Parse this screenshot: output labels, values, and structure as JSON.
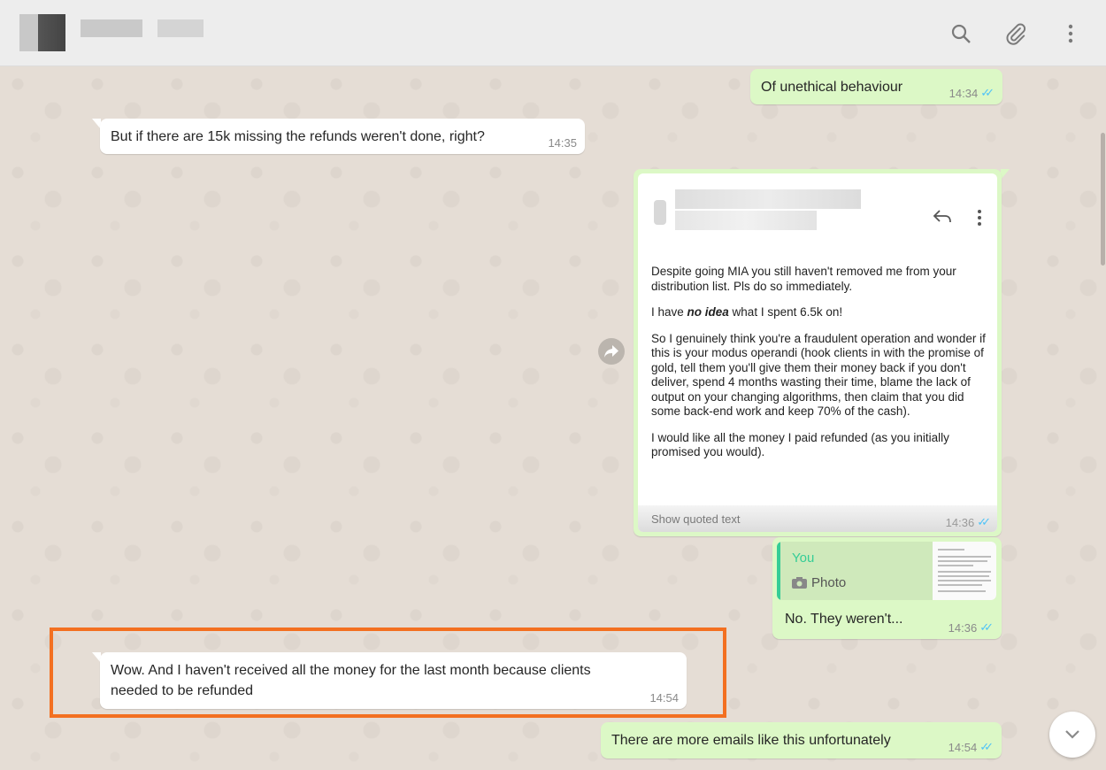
{
  "header": {
    "icons": [
      "search-icon",
      "paperclip-icon",
      "menu-dots-icon"
    ]
  },
  "messages": [
    {
      "id": "m1",
      "direction": "out",
      "text": "Of unethical behaviour",
      "time": "14:34"
    },
    {
      "id": "m2",
      "direction": "in",
      "text": "But if there are 15k missing the refunds weren't done, right?",
      "time": "14:35"
    },
    {
      "id": "m3",
      "direction": "out",
      "type": "image",
      "time": "14:36",
      "email": {
        "p1": "Despite going MIA you still haven't removed me from your distribution list. Pls do so immediately.",
        "p2_pre": "I have ",
        "p2_em": "no idea",
        "p2_post": " what I spent 6.5k on!",
        "p3": "So I genuinely think you're a fraudulent operation and wonder if this is your modus operandi (hook clients in with the promise of gold, tell them you'll give them their money back if you don't deliver, spend 4 months wasting their time, blame the lack of output on your changing algorithms, then claim that you did some back-end work and keep 70% of the cash).",
        "p4": "I would like all the money I paid refunded (as you initially promised you would).",
        "quoted_label": "Show quoted text"
      }
    },
    {
      "id": "m4",
      "direction": "out",
      "time": "14:36",
      "reply": {
        "author": "You",
        "kind": "Photo"
      },
      "text": "No. They weren't..."
    },
    {
      "id": "m5",
      "direction": "in",
      "text_line1": "Wow. And I haven't received all the money for the last month because clients",
      "text_line2": "needed to be refunded",
      "time": "14:54"
    },
    {
      "id": "m6",
      "direction": "out",
      "text": "There are more emails like this unfortunately",
      "time": "14:54"
    }
  ],
  "colors": {
    "outgoing_bubble": "#dcf8c6",
    "incoming_bubble": "#ffffff",
    "chat_background": "#e5ddd5",
    "read_ticks": "#4fc3f7",
    "highlight_border": "#f37021",
    "reply_author": "#35cd96"
  }
}
